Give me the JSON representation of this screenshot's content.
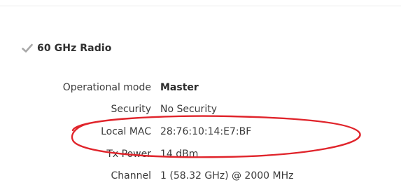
{
  "section": {
    "title": "60 GHz Radio",
    "icon": "check-icon"
  },
  "fields": [
    {
      "label": "Operational mode",
      "value": "Master",
      "bold": true
    },
    {
      "label": "Security",
      "value": "No Security",
      "bold": false
    },
    {
      "label": "Local MAC",
      "value": "28:76:10:14:E7:BF",
      "bold": false
    },
    {
      "label": "Tx Power",
      "value": "14 dBm",
      "bold": false
    },
    {
      "label": "Channel",
      "value": "1 (58.32 GHz) @ 2000 MHz",
      "bold": false
    }
  ],
  "colors": {
    "annotation": "#e0242b",
    "check": "#a8a8a8"
  }
}
